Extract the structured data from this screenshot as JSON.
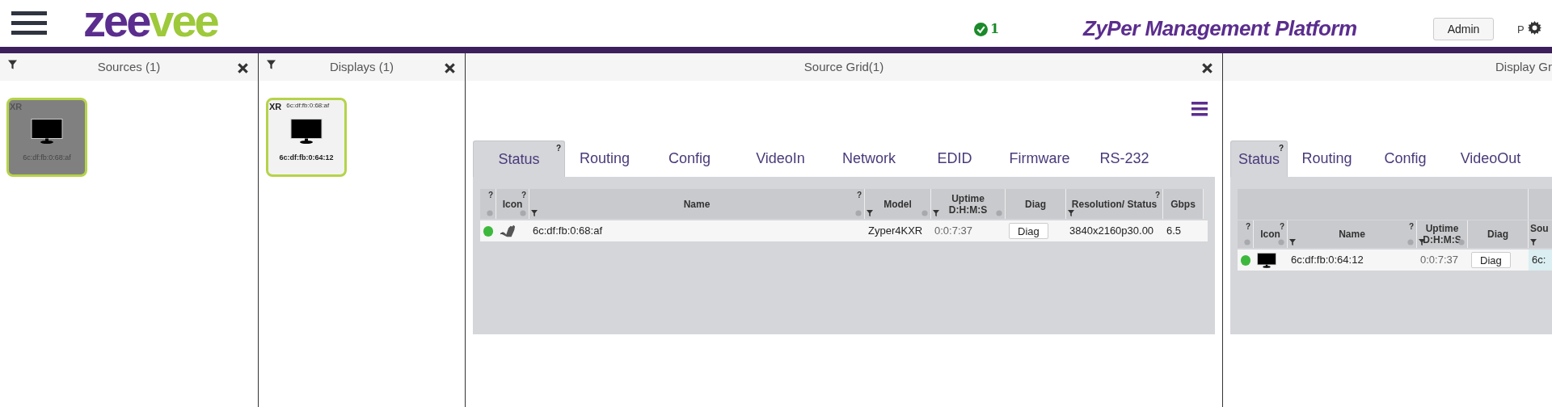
{
  "header": {
    "logo_parts": [
      {
        "text": "zee",
        "color": "#5b2d8e"
      },
      {
        "text": "vee",
        "color": "#9dc93b"
      }
    ],
    "alerts": {
      "count": "1"
    },
    "title": "ZyPer Management Platform",
    "user_button": "Admin",
    "settings_label": "P"
  },
  "sources_panel": {
    "title": "Sources (1)",
    "tiles": [
      {
        "tag": "XR",
        "label": "6c:df:fb:0:68:af",
        "selected": true
      }
    ]
  },
  "displays_panel": {
    "title": "Displays (1)",
    "tiles": [
      {
        "tag": "XR",
        "sublabel": "6c:df:fb:0:68:af",
        "label": "6c:df:fb:0:64:12",
        "selected": false
      }
    ]
  },
  "source_grid": {
    "title": "Source Grid(1)",
    "tabs": [
      {
        "label": "Status",
        "help": "?",
        "selected": true
      },
      {
        "label": "Routing",
        "selected": false
      },
      {
        "label": "Config",
        "selected": false
      },
      {
        "label": "VideoIn",
        "selected": false
      },
      {
        "label": "Network",
        "selected": false
      },
      {
        "label": "EDID",
        "selected": false
      },
      {
        "label": "Firmware",
        "selected": false
      },
      {
        "label": "RS-232",
        "selected": false
      }
    ],
    "columns": [
      {
        "help": "?",
        "sortable": true,
        "filter": false
      },
      {
        "label": "Icon",
        "help": "?",
        "sortable": true,
        "filter": false
      },
      {
        "label": "Name",
        "help": "?",
        "sortable": true,
        "filter": true
      },
      {
        "label": "Model",
        "sortable": true,
        "filter": true
      },
      {
        "label": "Uptime D:H:M:S",
        "sortable": true,
        "filter": true
      },
      {
        "label": "Diag",
        "sortable": false,
        "filter": false
      },
      {
        "label": "Resolution/ Status",
        "help": "?",
        "sortable": false,
        "filter": true
      },
      {
        "label": "Gbps",
        "sortable": false,
        "filter": false
      }
    ],
    "rows": [
      {
        "color": "#3cb93c",
        "name": "6c:df:fb:0:68:af",
        "model": "Zyper4KXR",
        "uptime": "0:0:7:37",
        "diag": "Diag",
        "resolution": "3840x2160p30.00",
        "gbps": "6.5"
      }
    ]
  },
  "display_grid": {
    "title": "Display Gr",
    "tabs": [
      {
        "label": "Status",
        "help": "?",
        "selected": true
      },
      {
        "label": "Routing",
        "selected": false
      },
      {
        "label": "Config",
        "selected": false
      },
      {
        "label": "VideoOut",
        "selected": false
      }
    ],
    "columns": [
      {
        "help": "?",
        "sortable": true,
        "filter": false
      },
      {
        "label": "Icon",
        "help": "?",
        "sortable": true,
        "filter": false
      },
      {
        "label": "Name",
        "help": "?",
        "sortable": true,
        "filter": true
      },
      {
        "label": "Uptime D:H:M:S",
        "sortable": true,
        "filter": true
      },
      {
        "label": "Diag",
        "sortable": false,
        "filter": false
      },
      {
        "label": "Sou",
        "sortable": false,
        "filter": true
      }
    ],
    "rows": [
      {
        "color": "#3cb93c",
        "name": "6c:df:fb:0:64:12",
        "uptime": "0:0:7:37",
        "diag": "Diag",
        "source": "6c:"
      }
    ]
  }
}
